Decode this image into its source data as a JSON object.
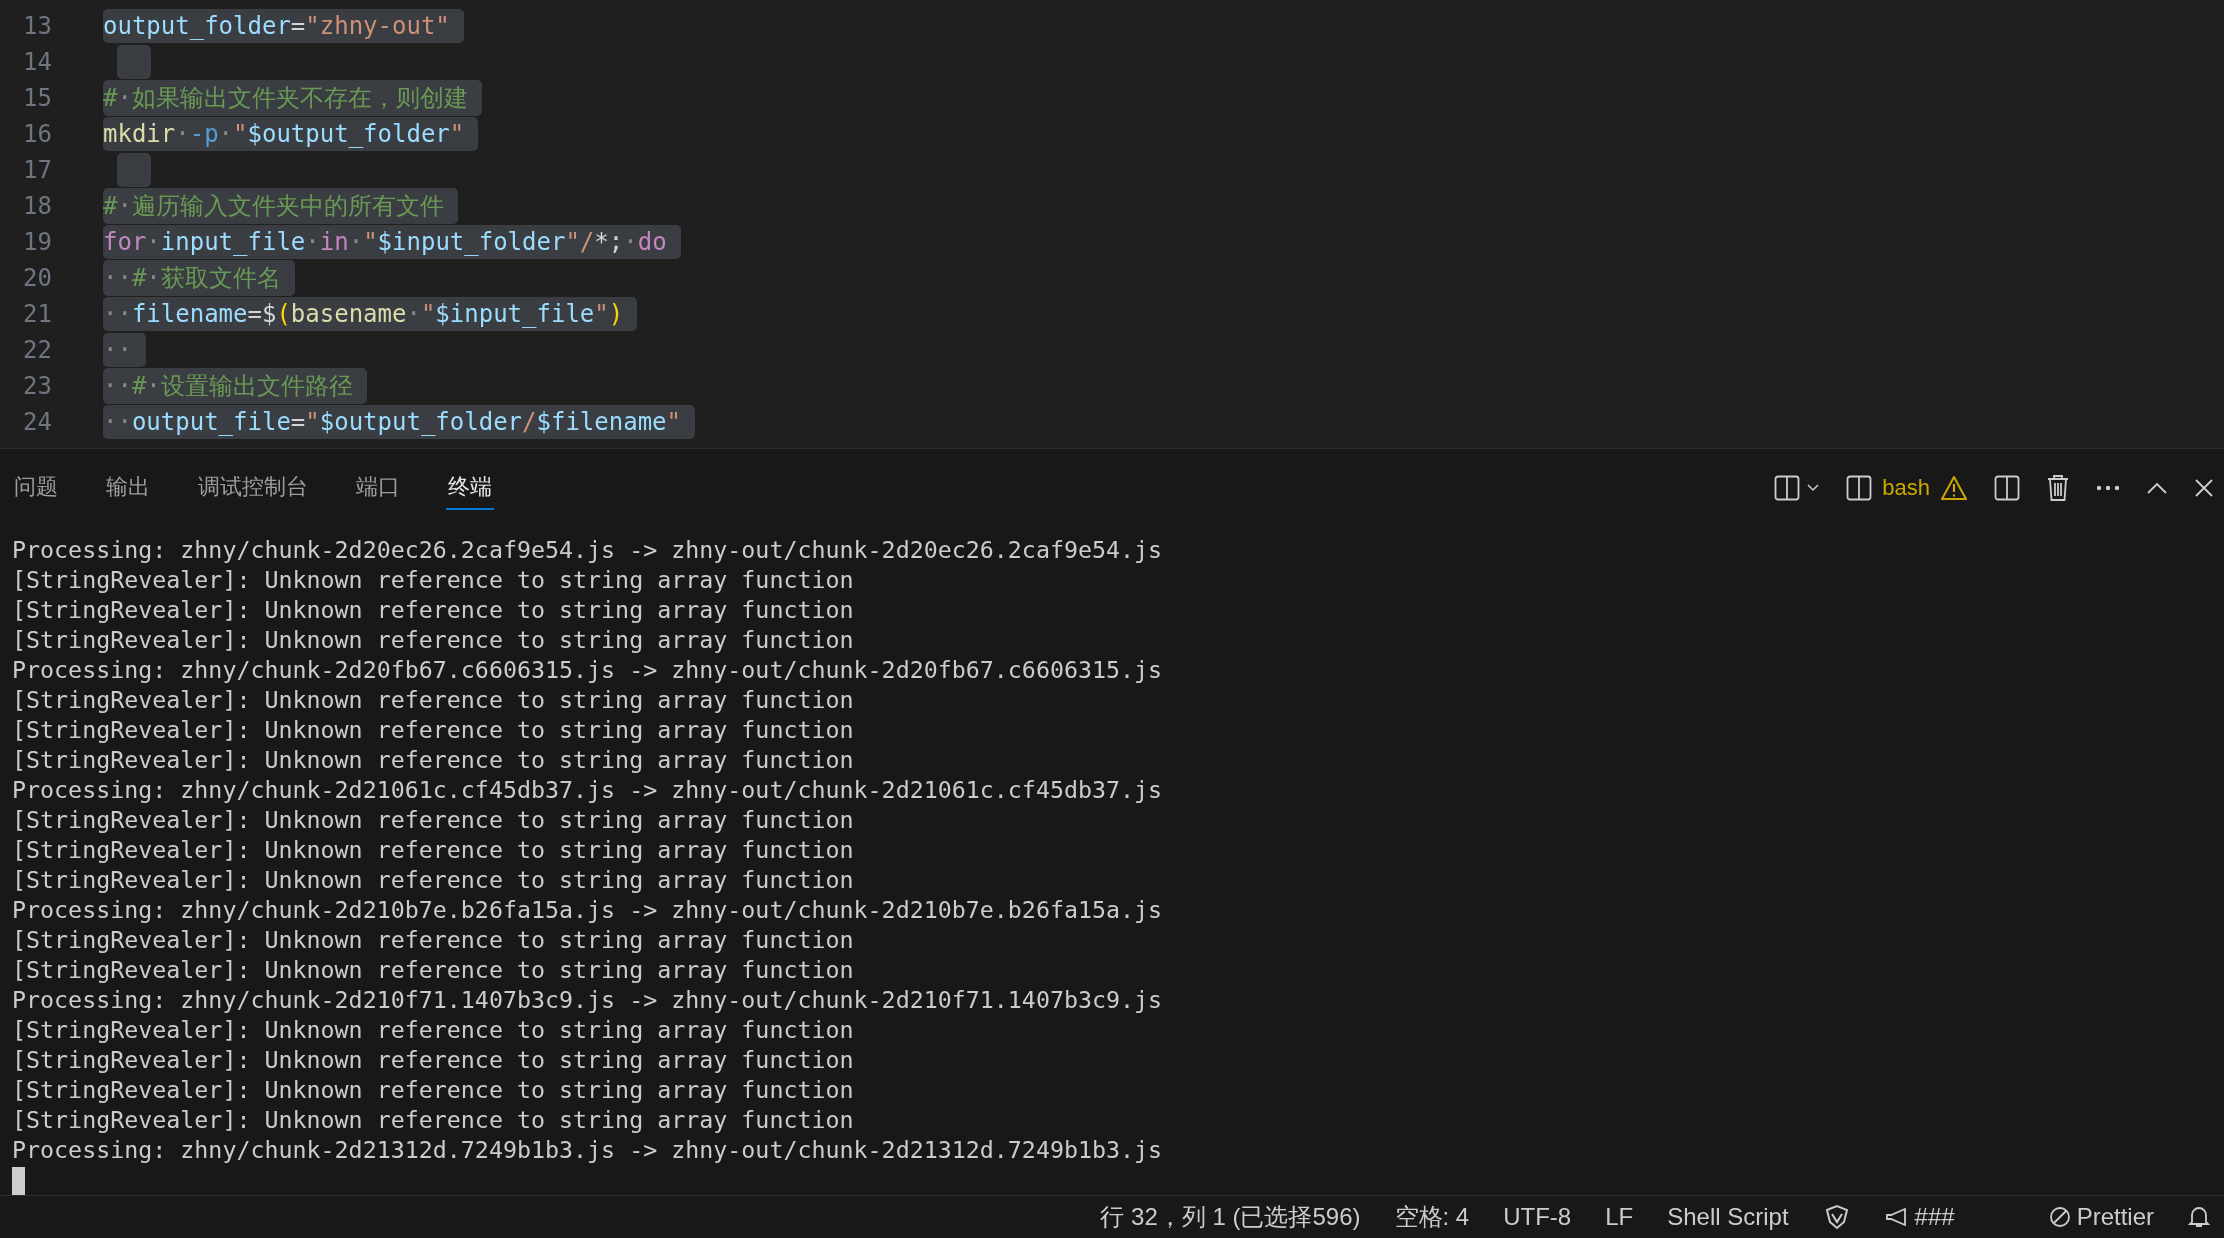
{
  "editor": {
    "lines": [
      {
        "number": "13",
        "tokens": [
          {
            "kind": "var",
            "text": "output_folder"
          },
          {
            "kind": "op",
            "text": "="
          },
          {
            "kind": "str",
            "text": "\"zhny-out\""
          }
        ]
      },
      {
        "number": "14"
      },
      {
        "number": "15",
        "tokens": [
          {
            "kind": "comment",
            "text": "#"
          },
          {
            "kind": "ws",
            "text": "·"
          },
          {
            "kind": "comment",
            "text": "如果输出文件夹不存在，则创建"
          }
        ]
      },
      {
        "number": "16",
        "tokens": [
          {
            "kind": "func",
            "text": "mkdir"
          },
          {
            "kind": "ws",
            "text": "·"
          },
          {
            "kind": "flag",
            "text": "-p"
          },
          {
            "kind": "ws",
            "text": "·"
          },
          {
            "kind": "str",
            "text": "\""
          },
          {
            "kind": "var",
            "text": "$output_folder"
          },
          {
            "kind": "str",
            "text": "\""
          }
        ]
      },
      {
        "number": "17"
      },
      {
        "number": "18",
        "tokens": [
          {
            "kind": "comment",
            "text": "#"
          },
          {
            "kind": "ws",
            "text": "·"
          },
          {
            "kind": "comment",
            "text": "遍历输入文件夹中的所有文件"
          }
        ]
      },
      {
        "number": "19",
        "tokens": [
          {
            "kind": "kw",
            "text": "for"
          },
          {
            "kind": "ws",
            "text": "·"
          },
          {
            "kind": "var",
            "text": "input_file"
          },
          {
            "kind": "ws",
            "text": "·"
          },
          {
            "kind": "kw",
            "text": "in"
          },
          {
            "kind": "ws",
            "text": "·"
          },
          {
            "kind": "str",
            "text": "\""
          },
          {
            "kind": "var",
            "text": "$input_folder"
          },
          {
            "kind": "str",
            "text": "\"/"
          },
          {
            "kind": "op",
            "text": "*;"
          },
          {
            "kind": "ws",
            "text": "·"
          },
          {
            "kind": "kw",
            "text": "do"
          }
        ]
      },
      {
        "number": "20",
        "tokens": [
          {
            "kind": "ws",
            "text": "··"
          },
          {
            "kind": "comment",
            "text": "#"
          },
          {
            "kind": "ws",
            "text": "·"
          },
          {
            "kind": "comment",
            "text": "获取文件名"
          }
        ]
      },
      {
        "number": "21",
        "tokens": [
          {
            "kind": "ws",
            "text": "··"
          },
          {
            "kind": "var",
            "text": "filename"
          },
          {
            "kind": "op",
            "text": "=$"
          },
          {
            "kind": "paren",
            "text": "("
          },
          {
            "kind": "func",
            "text": "basename"
          },
          {
            "kind": "ws",
            "text": "·"
          },
          {
            "kind": "str",
            "text": "\""
          },
          {
            "kind": "var",
            "text": "$input_file"
          },
          {
            "kind": "str",
            "text": "\""
          },
          {
            "kind": "paren",
            "text": ")"
          }
        ]
      },
      {
        "number": "22",
        "tokens": [
          {
            "kind": "ws",
            "text": "··"
          }
        ]
      },
      {
        "number": "23",
        "tokens": [
          {
            "kind": "ws",
            "text": "··"
          },
          {
            "kind": "comment",
            "text": "#"
          },
          {
            "kind": "ws",
            "text": "·"
          },
          {
            "kind": "comment",
            "text": "设置输出文件路径"
          }
        ]
      },
      {
        "number": "24",
        "tokens": [
          {
            "kind": "ws",
            "text": "··"
          },
          {
            "kind": "var",
            "text": "output_file"
          },
          {
            "kind": "op",
            "text": "="
          },
          {
            "kind": "str",
            "text": "\""
          },
          {
            "kind": "var",
            "text": "$output_folder"
          },
          {
            "kind": "str",
            "text": "/"
          },
          {
            "kind": "var",
            "text": "$filename"
          },
          {
            "kind": "str",
            "text": "\""
          }
        ]
      }
    ]
  },
  "panel": {
    "tabs": [
      {
        "label": "问题",
        "selected": false
      },
      {
        "label": "输出",
        "selected": false
      },
      {
        "label": "调试控制台",
        "selected": false
      },
      {
        "label": "端口",
        "selected": false
      },
      {
        "label": "终端",
        "selected": true
      }
    ],
    "terminal_name": "bash",
    "terminal_lines": [
      "Processing: zhny/chunk-2d20ec26.2caf9e54.js -> zhny-out/chunk-2d20ec26.2caf9e54.js",
      "[StringRevealer]: Unknown reference to string array function",
      "[StringRevealer]: Unknown reference to string array function",
      "[StringRevealer]: Unknown reference to string array function",
      "Processing: zhny/chunk-2d20fb67.c6606315.js -> zhny-out/chunk-2d20fb67.c6606315.js",
      "[StringRevealer]: Unknown reference to string array function",
      "[StringRevealer]: Unknown reference to string array function",
      "[StringRevealer]: Unknown reference to string array function",
      "Processing: zhny/chunk-2d21061c.cf45db37.js -> zhny-out/chunk-2d21061c.cf45db37.js",
      "[StringRevealer]: Unknown reference to string array function",
      "[StringRevealer]: Unknown reference to string array function",
      "[StringRevealer]: Unknown reference to string array function",
      "Processing: zhny/chunk-2d210b7e.b26fa15a.js -> zhny-out/chunk-2d210b7e.b26fa15a.js",
      "[StringRevealer]: Unknown reference to string array function",
      "[StringRevealer]: Unknown reference to string array function",
      "Processing: zhny/chunk-2d210f71.1407b3c9.js -> zhny-out/chunk-2d210f71.1407b3c9.js",
      "[StringRevealer]: Unknown reference to string array function",
      "[StringRevealer]: Unknown reference to string array function",
      "[StringRevealer]: Unknown reference to string array function",
      "[StringRevealer]: Unknown reference to string array function",
      "Processing: zhny/chunk-2d21312d.7249b1b3.js -> zhny-out/chunk-2d21312d.7249b1b3.js"
    ]
  },
  "status_bar": {
    "position": "行 32，列 1 (已选择596)",
    "indent": "空格: 4",
    "encoding": "UTF-8",
    "eol": "LF",
    "language": "Shell Script",
    "feedback": "###",
    "formatter": "Prettier"
  }
}
